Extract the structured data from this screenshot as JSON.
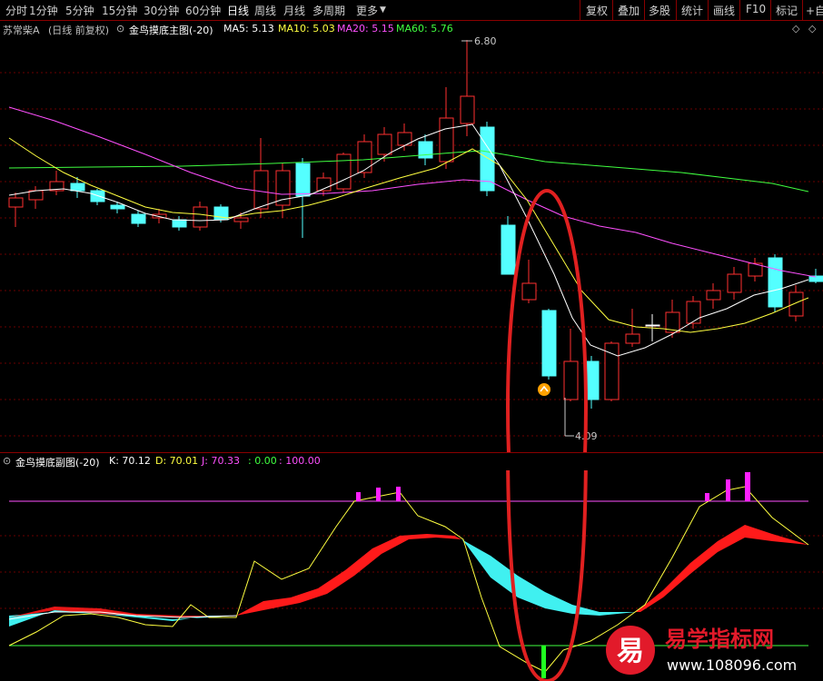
{
  "toolbar": {
    "periods": [
      "分时",
      "1分钟",
      "5分钟",
      "15分钟",
      "30分钟",
      "60分钟",
      "日线",
      "周线",
      "月线",
      "多周期",
      "更多"
    ],
    "actions": [
      "复权",
      "叠加",
      "多股",
      "统计",
      "画线",
      "F10",
      "标记",
      "+自"
    ]
  },
  "main_header": {
    "stock": "苏常柴A",
    "period_mode": "(日线 前复权)",
    "indicator": "金鸟摸底主图(-20)",
    "ma5": "MA5: 5.13",
    "ma10": "MA10: 5.03",
    "ma20": "MA20: 5.15",
    "ma60": "MA60: 5.76"
  },
  "main_chart": {
    "high_label": "6.80",
    "low_label": "4.09",
    "colors": {
      "up": "#ff3030",
      "down": "#54ffff",
      "ma5": "#ffffff",
      "ma10": "#ffff40",
      "ma20": "#ff50ff",
      "ma60": "#40ff40",
      "grid": "#6a0000"
    }
  },
  "sub_header": {
    "indicator": "金鸟摸底副图(-20)",
    "k": "K: 70.12",
    "d": "D: 70.01",
    "j": "J: 70.33",
    "v1": ": 0.00",
    "v2": ": 100.00"
  },
  "watermark": {
    "brand": "易学指标网",
    "url": "www.108096.com",
    "glyph": "易"
  }
}
